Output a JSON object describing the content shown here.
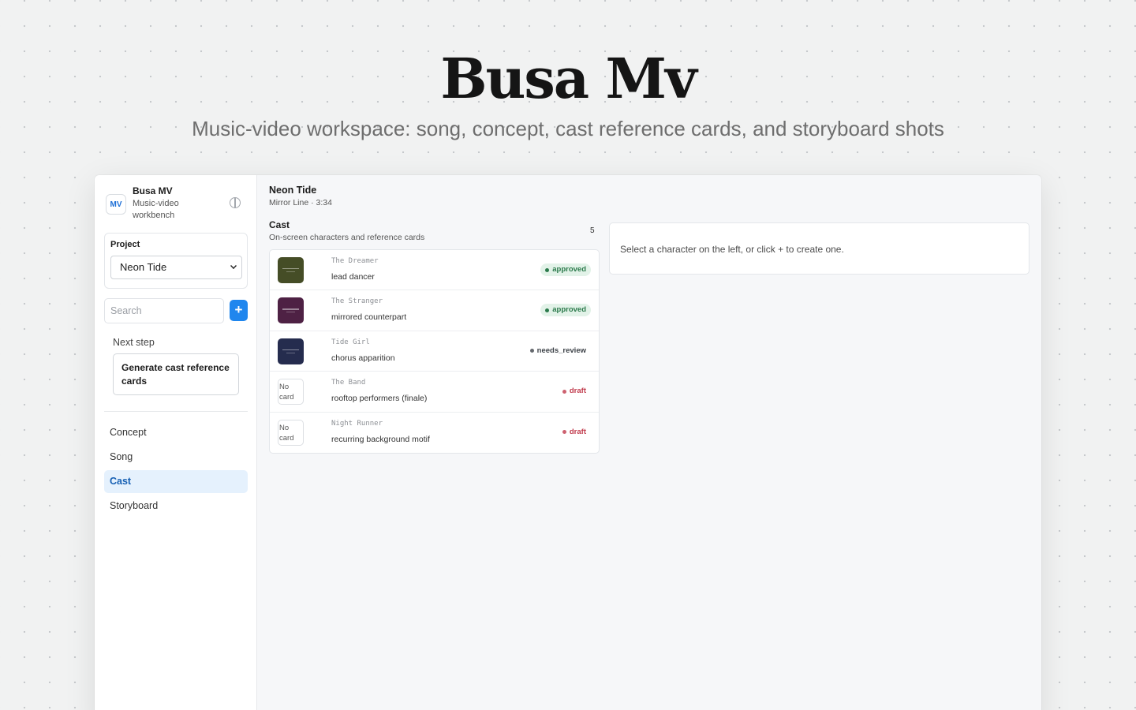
{
  "hero": {
    "title": "Busa Mv",
    "subtitle": "Music-video workspace: song, concept, cast reference cards, and storyboard shots"
  },
  "sidebar": {
    "brand": {
      "logo": "MV",
      "name": "Busa MV",
      "tagline": "Music-video workbench"
    },
    "theme_icon": "half-circle-icon",
    "project": {
      "label": "Project",
      "selected": "Neon Tide"
    },
    "search": {
      "placeholder": "Search"
    },
    "add_button": "+",
    "next_step": {
      "label": "Next step",
      "action": "Generate cast reference cards"
    },
    "nav": [
      {
        "label": "Concept",
        "active": false
      },
      {
        "label": "Song",
        "active": false
      },
      {
        "label": "Cast",
        "active": true
      },
      {
        "label": "Storyboard",
        "active": false
      }
    ]
  },
  "main": {
    "song_title": "Neon Tide",
    "song_meta": "Mirror Line · 3:34",
    "cast": {
      "title": "Cast",
      "subtitle": "On-screen characters and reference cards",
      "count": "5",
      "rows": [
        {
          "name": "The Dreamer",
          "role": "lead dancer",
          "status": "approved",
          "thumb_color": "#454d26"
        },
        {
          "name": "The Stranger",
          "role": "mirrored counterpart",
          "status": "approved",
          "thumb_color": "#4e2144"
        },
        {
          "name": "Tide Girl",
          "role": "chorus apparition",
          "status": "needs_review",
          "thumb_color": "#252c4e"
        },
        {
          "name": "The Band",
          "role": "rooftop performers (finale)",
          "status": "draft",
          "no_card": "No card"
        },
        {
          "name": "Night Runner",
          "role": "recurring background motif",
          "status": "draft",
          "no_card": "No card"
        }
      ]
    },
    "detail": {
      "message": "Select a character on the left, or click + to create one."
    }
  },
  "colors": {
    "accent": "#1f86ee",
    "approved": "#2b7a4b",
    "needs_review": "#3d4248",
    "draft": "#c0394b"
  }
}
